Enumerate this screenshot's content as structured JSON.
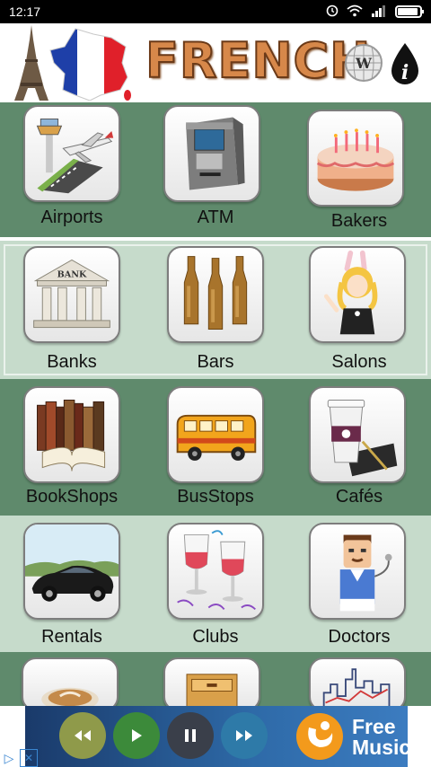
{
  "status_bar": {
    "time": "12:17"
  },
  "header": {
    "title": "FRENCH",
    "icons": [
      "eiffel-tower-icon",
      "france-map-icon",
      "wikipedia-icon",
      "info-drop-icon"
    ]
  },
  "categories": [
    {
      "label": "Airports",
      "icon": "airport-icon"
    },
    {
      "label": "ATM",
      "icon": "atm-icon"
    },
    {
      "label": "Bakers",
      "icon": "cake-icon"
    },
    {
      "label": "Banks",
      "icon": "bank-icon"
    },
    {
      "label": "Bars",
      "icon": "beer-bottles-icon"
    },
    {
      "label": "Salons",
      "icon": "salon-icon"
    },
    {
      "label": "BookShops",
      "icon": "books-icon"
    },
    {
      "label": "BusStops",
      "icon": "bus-icon"
    },
    {
      "label": "Cafés",
      "icon": "coffee-cup-icon"
    },
    {
      "label": "Rentals",
      "icon": "car-icon"
    },
    {
      "label": "Clubs",
      "icon": "wine-glasses-icon"
    },
    {
      "label": "Doctors",
      "icon": "doctor-icon"
    }
  ],
  "partial_row_icons": [
    "latte-icon",
    "filing-cabinet-icon",
    "skyline-chart-icon"
  ],
  "ad": {
    "text_line1": "Free",
    "text_line2": "Music",
    "controls": [
      "rewind-icon",
      "play-icon",
      "pause-icon",
      "fast-forward-icon"
    ]
  },
  "colors": {
    "row_dark": "#5f8a6c",
    "row_light": "#c6dbcb",
    "title": "#d7884a"
  }
}
